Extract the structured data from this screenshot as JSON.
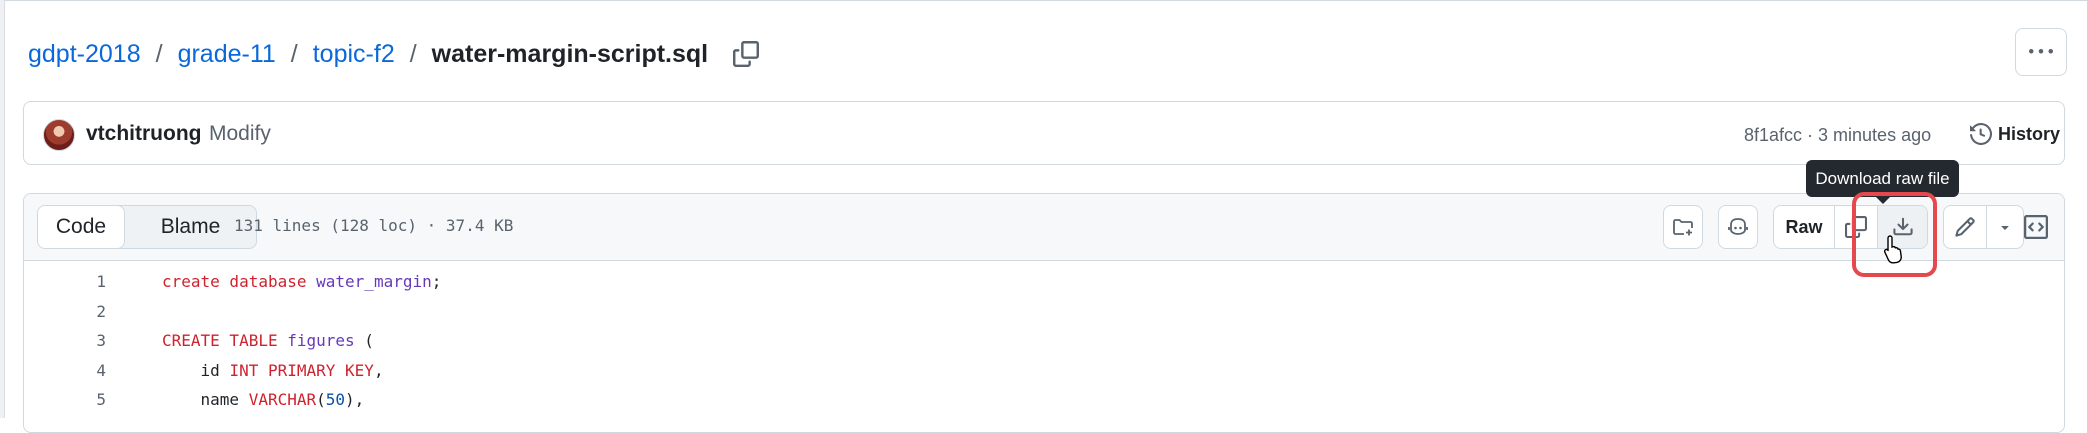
{
  "breadcrumb": {
    "repo": "gdpt-2018",
    "folder1": "grade-11",
    "folder2": "topic-f2",
    "file": "water-margin-script.sql",
    "separator": "/"
  },
  "commit": {
    "author": "vtchitruong",
    "message": "Modify",
    "meta": "8f1afcc · 3 minutes ago",
    "history_label": "History"
  },
  "file_header": {
    "tabs": [
      "Code",
      "Blame"
    ],
    "info": "131 lines (128 loc) · 37.4 KB",
    "raw_label": "Raw",
    "tooltip": "Download raw file"
  },
  "code_lines": [
    {
      "n": "1",
      "parts": [
        [
          "create database",
          "kw"
        ],
        [
          " ",
          ""
        ],
        [
          "water_margin",
          "ent"
        ],
        [
          ";",
          ""
        ]
      ]
    },
    {
      "n": "2",
      "parts": []
    },
    {
      "n": "3",
      "parts": [
        [
          "CREATE TABLE",
          "kw"
        ],
        [
          " ",
          ""
        ],
        [
          "figures",
          "ent"
        ],
        [
          " (",
          ""
        ]
      ]
    },
    {
      "n": "4",
      "parts": [
        [
          "    id ",
          ""
        ],
        [
          "INT PRIMARY KEY",
          "kw"
        ],
        [
          ",",
          ""
        ]
      ]
    },
    {
      "n": "5",
      "parts": [
        [
          "    name ",
          ""
        ],
        [
          "VARCHAR",
          "kw"
        ],
        [
          "(",
          ""
        ],
        [
          "50",
          "num"
        ],
        [
          "),",
          ""
        ]
      ]
    }
  ],
  "colors": {
    "link": "#0969da",
    "keyword": "#cf222e",
    "entity": "#6639ba",
    "number": "#0550ae",
    "highlight": "#e5484d"
  },
  "icons": [
    "copy-icon",
    "kebab-icon",
    "history-icon",
    "folder-plus-icon",
    "copilot-icon",
    "copy-icon",
    "download-icon",
    "pencil-icon",
    "chevron-down-icon",
    "symbols-panel-icon",
    "pointer-cursor-icon"
  ]
}
